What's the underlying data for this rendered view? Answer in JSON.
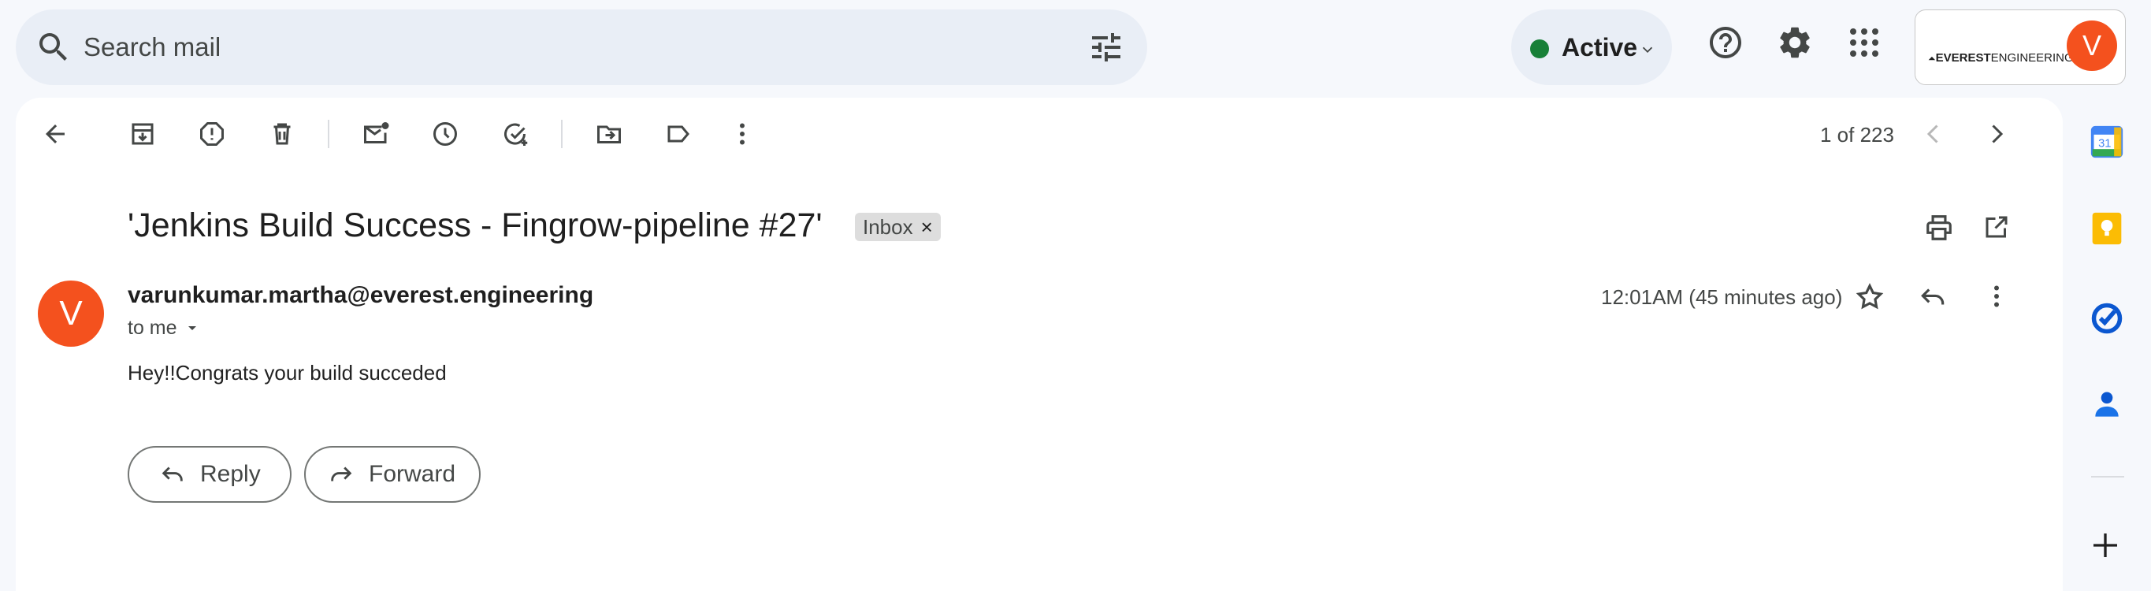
{
  "search": {
    "placeholder": "Search mail"
  },
  "status": {
    "label": "Active",
    "color": "#188038"
  },
  "account": {
    "logo_bold": "EVEREST",
    "logo_light": "ENGINEERING",
    "avatar_letter": "V"
  },
  "pager": {
    "text": "1 of 223"
  },
  "email": {
    "subject": "'Jenkins Build Success - Fingrow-pipeline #27'",
    "label_chip": "Inbox",
    "label_remove": "×",
    "sender": "varunkumar.martha@everest.engineering",
    "sender_avatar_letter": "V",
    "recipient": "to me",
    "timestamp": "12:01AM (45 minutes ago)",
    "body": "Hey!!Congrats your build succeded"
  },
  "actions": {
    "reply": "Reply",
    "forward": "Forward"
  },
  "side_panel": {
    "calendar_day": "31"
  },
  "colors": {
    "accent": "#0b57d0",
    "avatar": "#f4511e",
    "background": "#f6f8fc"
  }
}
